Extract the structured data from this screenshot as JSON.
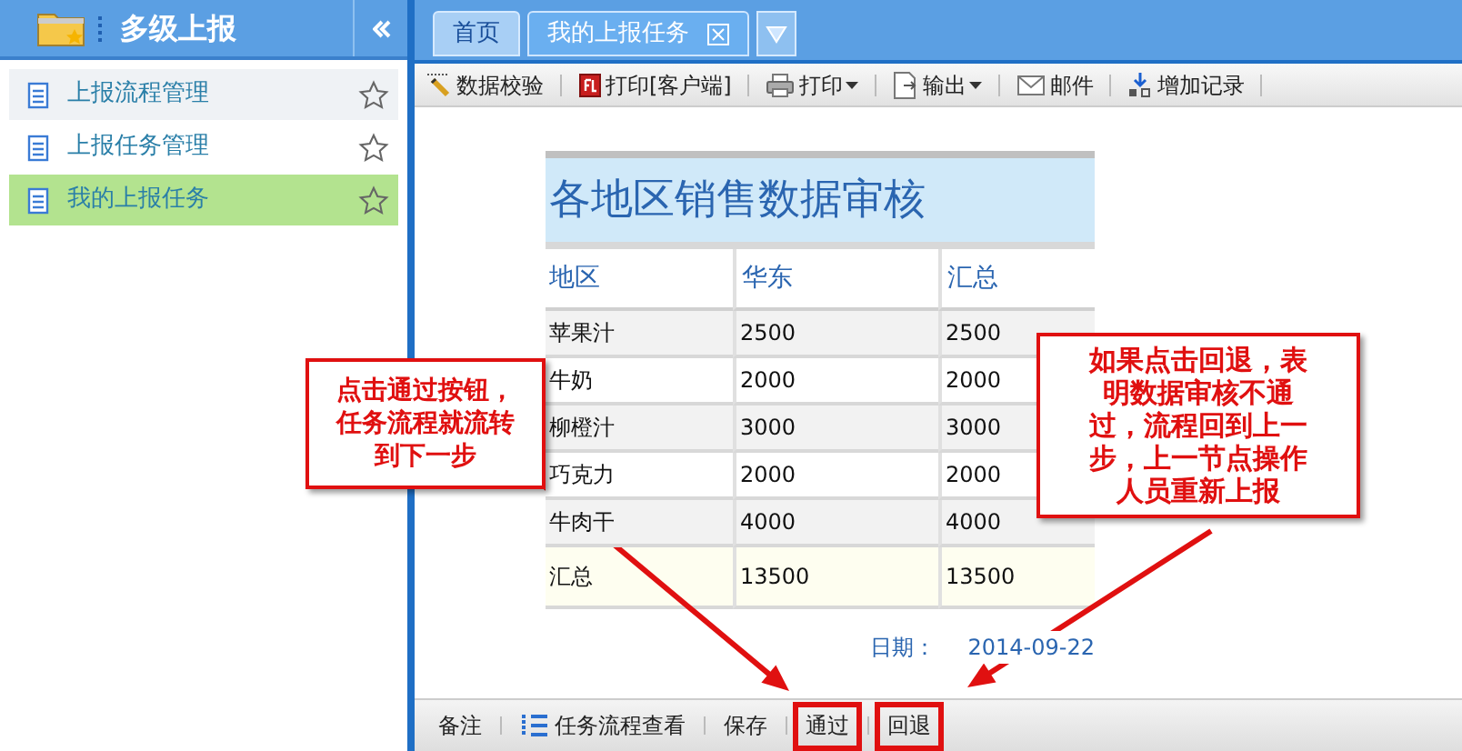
{
  "sidebar": {
    "title": "多级上报",
    "items": [
      {
        "label": "上报流程管理",
        "selected": false,
        "hovered": true
      },
      {
        "label": "上报任务管理",
        "selected": false,
        "hovered": false
      },
      {
        "label": "我的上报任务",
        "selected": true,
        "hovered": false
      }
    ]
  },
  "tabs": [
    {
      "label": "首页",
      "selected": false,
      "closable": false
    },
    {
      "label": "我的上报任务",
      "selected": true,
      "closable": true
    }
  ],
  "toolbar": [
    {
      "label": "数据校验",
      "kind": "pencil",
      "dropdown": false
    },
    {
      "label": "打印[客户端]",
      "kind": "flash",
      "dropdown": false
    },
    {
      "label": "打印",
      "kind": "printer",
      "dropdown": true
    },
    {
      "label": "输出",
      "kind": "export",
      "dropdown": true
    },
    {
      "label": "邮件",
      "kind": "mail",
      "dropdown": false
    },
    {
      "label": "增加记录",
      "kind": "add",
      "dropdown": false
    }
  ],
  "report": {
    "title": "各地区销售数据审核",
    "columns": [
      "地区",
      "华东",
      "汇总"
    ],
    "rows": [
      [
        "苹果汁",
        "2500",
        "2500"
      ],
      [
        "牛奶",
        "2000",
        "2000"
      ],
      [
        "柳橙汁",
        "3000",
        "3000"
      ],
      [
        "巧克力",
        "2000",
        "2000"
      ],
      [
        "牛肉干",
        "4000",
        "4000"
      ]
    ],
    "total": [
      "汇总",
      "13500",
      "13500"
    ],
    "date_label": "日期：",
    "date_value": "2014-09-22"
  },
  "bottom_bar": [
    {
      "label": "备注",
      "kind": "plain",
      "highlighted": false
    },
    {
      "label": "任务流程查看",
      "kind": "list",
      "highlighted": false
    },
    {
      "label": "保存",
      "kind": "plain",
      "highlighted": false
    },
    {
      "label": "通过",
      "kind": "plain",
      "highlighted": true
    },
    {
      "label": "回退",
      "kind": "plain",
      "highlighted": true
    }
  ],
  "annotations": [
    {
      "text": "点击通过按钮，任务流程就流转到下一步"
    },
    {
      "text": "如果点击回退，表明数据审核不通过，流程回到上一步，上一节点操作人员重新上报"
    }
  ]
}
